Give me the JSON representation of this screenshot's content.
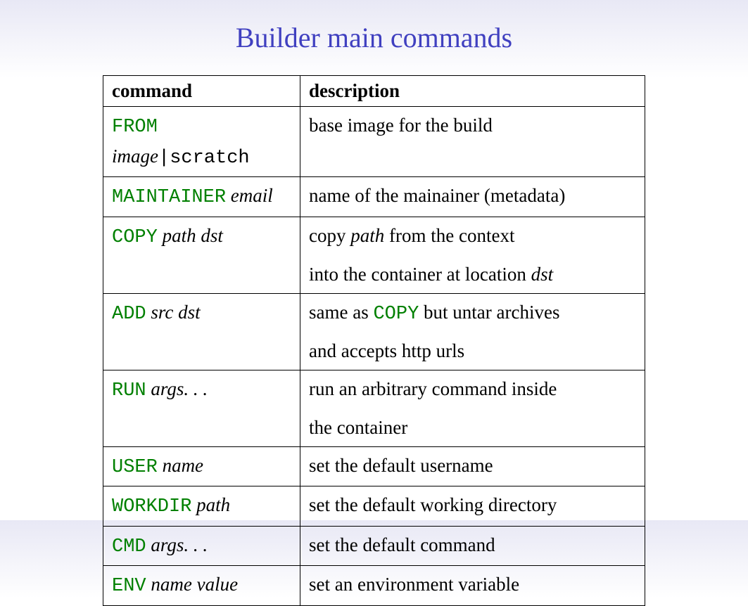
{
  "title": "Builder main commands",
  "headers": {
    "col1": "command",
    "col2": "description"
  },
  "rows": {
    "from": {
      "cmd": "FROM",
      "arg1": "image",
      "pipe": "|",
      "arg2": "scratch",
      "desc": "base image for the build"
    },
    "maintainer": {
      "cmd": "MAINTAINER",
      "arg": "email",
      "desc": "name of the mainainer (metadata)"
    },
    "copy": {
      "cmd": "COPY",
      "arg": "path dst",
      "desc_a": "copy ",
      "desc_b_arg": "path",
      "desc_c": " from the context",
      "desc_line2a": "into the container at location ",
      "desc_line2b_arg": "dst"
    },
    "add": {
      "cmd": "ADD",
      "arg": "src dst",
      "desc_a": "same as ",
      "desc_b_cmd": "COPY",
      "desc_c": " but untar archives",
      "desc_line2": "and accepts http urls"
    },
    "run": {
      "cmd": "RUN",
      "arg": "args. . .",
      "desc": "run an arbitrary command inside",
      "desc_line2": "the container"
    },
    "user": {
      "cmd": "USER",
      "arg": "name",
      "desc": "set the default username"
    },
    "workdir": {
      "cmd": "WORKDIR",
      "arg": "path",
      "desc": "set the default working directory"
    },
    "cmd": {
      "cmd": "CMD",
      "arg": "args. . .",
      "desc": "set the default command"
    },
    "env": {
      "cmd": "ENV",
      "arg": "name value",
      "desc": "set an environment variable"
    }
  }
}
